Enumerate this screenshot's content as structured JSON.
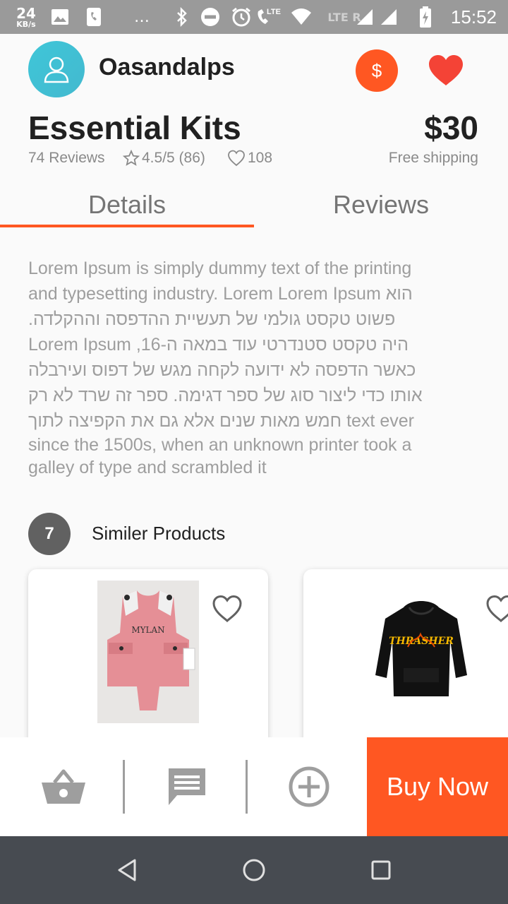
{
  "status_bar": {
    "speed_value": "24",
    "speed_unit": "KB/s",
    "network_label": "LTE",
    "roaming_label": "LTE R",
    "time": "15:52"
  },
  "seller": {
    "name": "Oasandalps"
  },
  "product": {
    "title": "Essential Kits",
    "price": "$30",
    "reviews_count": "74 Reviews",
    "rating": "4.5/5 (86)",
    "likes": "108",
    "shipping": "Free shipping"
  },
  "tabs": {
    "details_label": "Details",
    "reviews_label": "Reviews",
    "active": "Details"
  },
  "description_lines": [
    "Lorem Ipsum is simply dummy text of the printing",
    "and typesetting industry. Lorem Lorem Ipsum  הוא",
    ".פשוט טקסט גולמי של תעשיית ההדפסה וההקלדה",
    "Lorem Ipsum  ,היה טקסט סטנדרטי עוד במאה ה-16",
    " כאשר הדפסה לא ידועה לקחה מגש של דפוס ועירבלה",
    " אותו כדי ליצור סוג של ספר דגימה. ספר זה שרד לא רק",
    "חמש מאות שנים אלא גם את הקפיצה לתוך text ever",
    "since the 1500s, when an unknown printer took a",
    "galley of type and scrambled it"
  ],
  "similar": {
    "count": "7",
    "title": "Similer Products",
    "items": [
      {
        "image_icon": "pink-romper-image",
        "embroidery": "MYLAN"
      },
      {
        "image_icon": "black-hoodie-image",
        "print": "THRASHER"
      }
    ]
  },
  "bottom_actions": {
    "buy_now_label": "Buy Now"
  },
  "colors": {
    "accent": "#ff5722",
    "avatar": "#3fc6d8",
    "heart": "#f44336",
    "navbar": "#474b51"
  }
}
